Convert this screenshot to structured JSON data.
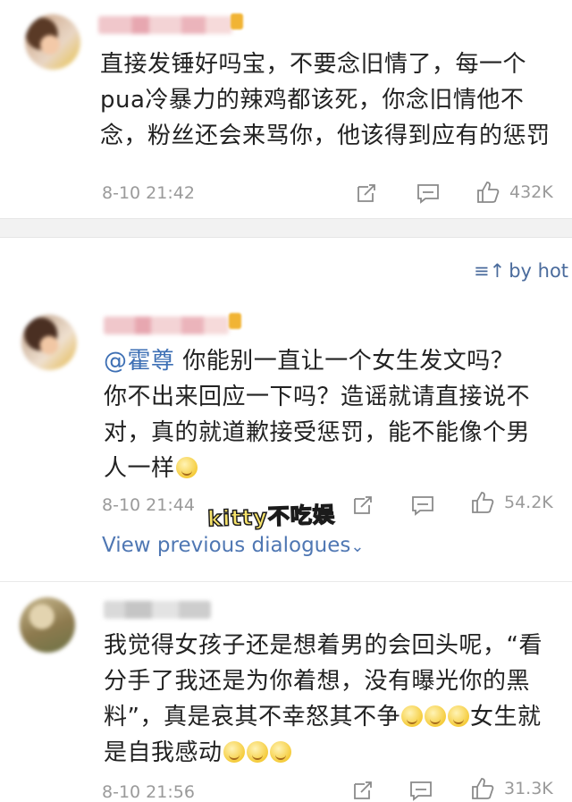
{
  "top_comment": {
    "text": "直接发锤好吗宝，不要念旧情了，每一个pua冷暴力的辣鸡都该死，你念旧情他不念，粉丝还会来骂你，他该得到应有的惩罚",
    "lines": [
      "直接发锤好吗宝，不要念旧情了，每一个",
      "pua冷暴力的辣鸡都该死，你念旧情他不",
      "念，粉丝还会来骂你，他该得到应有的惩罚"
    ],
    "time": "8-10 21:42",
    "likes": "432K"
  },
  "sort": {
    "icon": "sort-icon",
    "label": "by hot"
  },
  "comments": [
    {
      "mention": "@霍尊",
      "line1_rest": " 你能别一直让一个女生发文吗？",
      "line2": "你不出来回应一下吗？造谣就请直接说不",
      "line3": "对，真的就道歉接受惩罚，能不能像个男",
      "line4": "人一样",
      "time": "8-10 21:44",
      "likes": "54.2K"
    },
    {
      "line1": "我觉得女孩子还是想着男的会回头呢，“看",
      "line2": "分手了我还是为你着想，没有曝光你的黑",
      "line3a": "料”，真是哀其不幸怒其不争",
      "line3b": "女生就",
      "line4": "是自我感动",
      "time": "8-10 21:56",
      "likes": "31.3K"
    }
  ],
  "view_previous": "View previous dialogues",
  "watermark": "kitty不吃娱",
  "colors": {
    "link": "#4f77b3",
    "mention": "#3d6fb4",
    "meta": "#9a9a9a",
    "divider": "#f2f2f2"
  }
}
